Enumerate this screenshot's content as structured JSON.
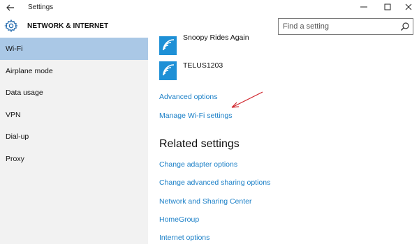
{
  "window": {
    "title": "Settings",
    "controls": {
      "minimize": "—",
      "maximize": "☐",
      "close": "✕"
    }
  },
  "header": {
    "section_title": "NETWORK & INTERNET",
    "search_placeholder": "Find a setting",
    "icons": {
      "settings": "gear-icon",
      "search": "search-icon",
      "back": "back-arrow-icon"
    }
  },
  "sidebar": {
    "items": [
      {
        "label": "Wi-Fi",
        "active": true
      },
      {
        "label": "Airplane mode",
        "active": false
      },
      {
        "label": "Data usage",
        "active": false
      },
      {
        "label": "VPN",
        "active": false
      },
      {
        "label": "Dial-up",
        "active": false
      },
      {
        "label": "Proxy",
        "active": false
      }
    ]
  },
  "main": {
    "networks": [
      {
        "name": "Snoopy Rides Again"
      },
      {
        "name": "TELUS1203"
      }
    ],
    "links": {
      "advanced_options": "Advanced options",
      "manage_wifi": "Manage Wi-Fi settings"
    },
    "related": {
      "heading": "Related settings",
      "links": [
        "Change adapter options",
        "Change advanced sharing options",
        "Network and Sharing Center",
        "HomeGroup",
        "Internet options"
      ]
    }
  },
  "colors": {
    "accent": "#1a7fc7",
    "sidebar_active": "#aac8e6",
    "sidebar_bg": "#f2f2f2",
    "wifi_tile": "#1e90d6",
    "annotation_arrow": "#d0242b"
  }
}
